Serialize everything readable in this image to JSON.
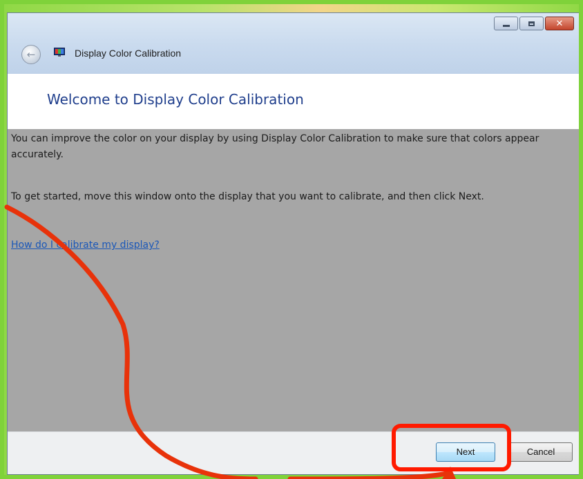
{
  "window": {
    "title": "Display Color Calibration",
    "caption_buttons": [
      "minimize-icon",
      "maximize-icon",
      "close-icon"
    ]
  },
  "header": {
    "heading": "Welcome to Display Color Calibration"
  },
  "content": {
    "paragraph1": "You can improve the color on your display by using Display Color Calibration to make sure that colors appear accurately.",
    "paragraph2": "To get started, move this window onto the display that you want to calibrate, and then click Next.",
    "help_link": "How do I calibrate my display?"
  },
  "footer": {
    "next_label": "Next",
    "cancel_label": "Cancel"
  },
  "annotation": {
    "highlight_color": "#ff1a00",
    "arrow_color": "#e8320a",
    "page_border_color": "#7fd23a"
  }
}
